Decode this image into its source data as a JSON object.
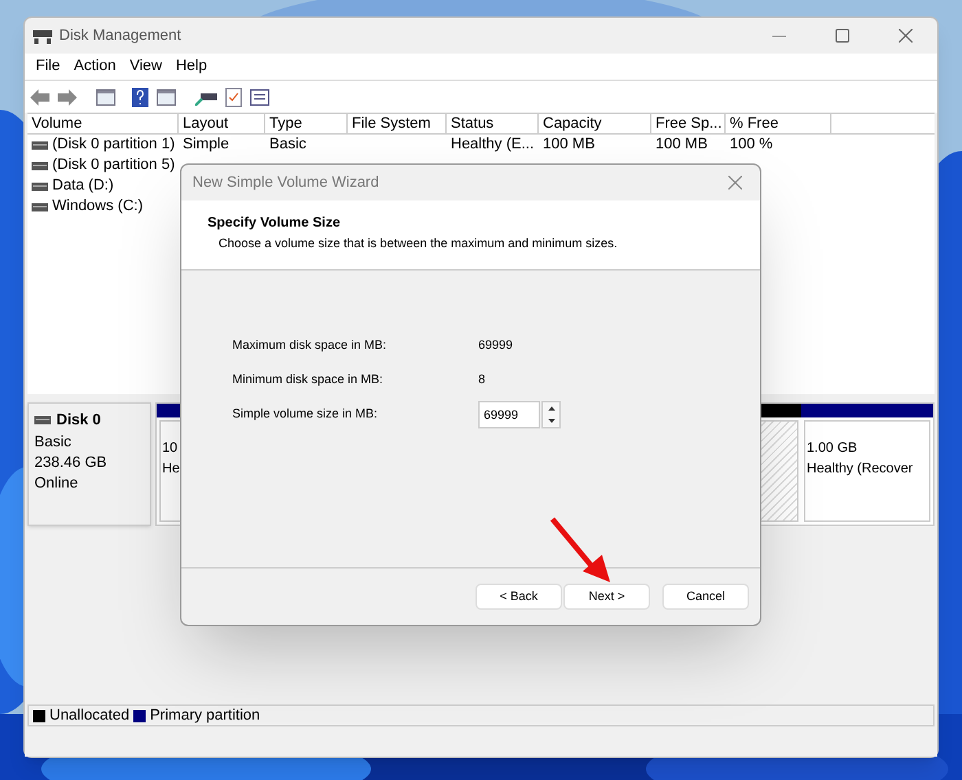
{
  "window": {
    "title": "Disk Management"
  },
  "menu": [
    "File",
    "Action",
    "View",
    "Help"
  ],
  "table": {
    "columns": [
      "Volume",
      "Layout",
      "Type",
      "File System",
      "Status",
      "Capacity",
      "Free Sp...",
      "% Free"
    ],
    "rows": [
      [
        "(Disk 0 partition 1)",
        "Simple",
        "Basic",
        "",
        "Healthy (E...",
        "100 MB",
        "100 MB",
        "100 %"
      ],
      [
        "(Disk 0 partition 5)"
      ],
      [
        "Data (D:)"
      ],
      [
        "Windows (C:)"
      ]
    ]
  },
  "disk": {
    "name": "Disk 0",
    "lines": [
      "Basic",
      "238.46 GB",
      "Online"
    ],
    "partitions": [
      {
        "kind": "primary",
        "lines": [
          "10",
          "He"
        ]
      },
      {
        "kind": "unallocated"
      },
      {
        "kind": "primary",
        "lines": [
          "1.00 GB",
          "Healthy (Recover"
        ]
      }
    ]
  },
  "legend": [
    {
      "label": "Unallocated",
      "color": "#000000"
    },
    {
      "label": "Primary partition",
      "color": "#000080"
    }
  ],
  "dialog": {
    "title": "New Simple Volume Wizard",
    "heading": "Specify Volume Size",
    "subheading": "Choose a volume size that is between the maximum and minimum sizes.",
    "fields": [
      {
        "kind": "text",
        "label": "Maximum disk space in MB:",
        "value": "69999"
      },
      {
        "kind": "text",
        "label": "Minimum disk space in MB:",
        "value": "8"
      },
      {
        "kind": "spin",
        "label": "Simple volume size in MB:",
        "value": "69999"
      }
    ],
    "buttons": [
      "< Back",
      "Next >",
      "Cancel"
    ]
  }
}
